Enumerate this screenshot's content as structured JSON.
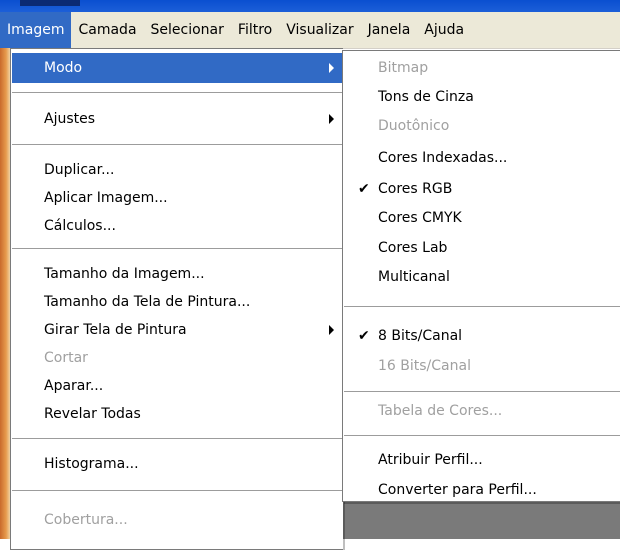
{
  "menubar": {
    "items": [
      {
        "label": "Imagem"
      },
      {
        "label": "Camada"
      },
      {
        "label": "Selecionar"
      },
      {
        "label": "Filtro"
      },
      {
        "label": "Visualizar"
      },
      {
        "label": "Janela"
      },
      {
        "label": "Ajuda"
      }
    ]
  },
  "image_menu": {
    "items": [
      {
        "label": "Modo"
      },
      {
        "label": "Ajustes"
      },
      {
        "label": "Duplicar..."
      },
      {
        "label": "Aplicar Imagem..."
      },
      {
        "label": "Cálculos..."
      },
      {
        "label": "Tamanho da Imagem..."
      },
      {
        "label": "Tamanho da Tela de Pintura..."
      },
      {
        "label": "Girar Tela de Pintura"
      },
      {
        "label": "Cortar"
      },
      {
        "label": "Aparar..."
      },
      {
        "label": "Revelar Todas"
      },
      {
        "label": "Histograma..."
      },
      {
        "label": "Cobertura..."
      }
    ]
  },
  "mode_submenu": {
    "items": [
      {
        "label": "Bitmap"
      },
      {
        "label": "Tons de Cinza"
      },
      {
        "label": "Duotônico"
      },
      {
        "label": "Cores Indexadas..."
      },
      {
        "label": "Cores RGB"
      },
      {
        "label": "Cores CMYK"
      },
      {
        "label": "Cores Lab"
      },
      {
        "label": "Multicanal"
      },
      {
        "label": "8 Bits/Canal"
      },
      {
        "label": "16 Bits/Canal"
      },
      {
        "label": "Tabela de Cores..."
      },
      {
        "label": "Atribuir Perfil..."
      },
      {
        "label": "Converter para Perfil..."
      }
    ],
    "check_glyph": "✔"
  },
  "colors": {
    "highlight": "#316ac5",
    "disabled": "#a0a0a0",
    "menubar_bg": "#ece9d8"
  }
}
